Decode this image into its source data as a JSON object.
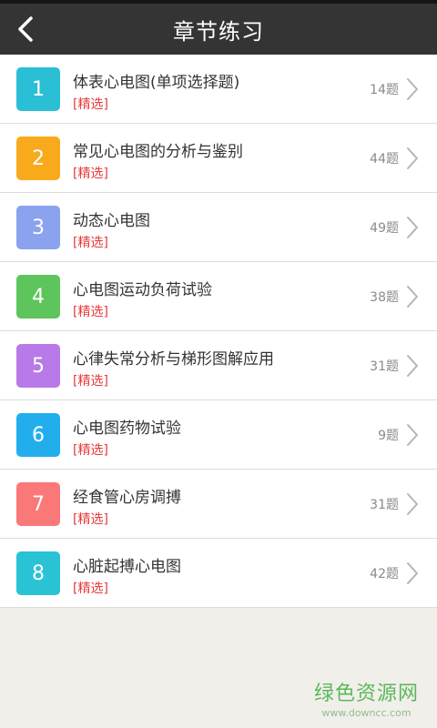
{
  "header": {
    "title": "章节练习"
  },
  "chapters": [
    {
      "num": "1",
      "name": "体表心电图(单项选择题)",
      "tag": "[精选]",
      "count": "14题",
      "color": "#2bbfd6"
    },
    {
      "num": "2",
      "name": "常见心电图的分析与鉴别",
      "tag": "[精选]",
      "count": "44题",
      "color": "#f9aa1c"
    },
    {
      "num": "3",
      "name": "动态心电图",
      "tag": "[精选]",
      "count": "49题",
      "color": "#8ba2ee"
    },
    {
      "num": "4",
      "name": "心电图运动负荷试验",
      "tag": "[精选]",
      "count": "38题",
      "color": "#5dc55b"
    },
    {
      "num": "5",
      "name": "心律失常分析与梯形图解应用",
      "tag": "[精选]",
      "count": "31题",
      "color": "#b77ae8"
    },
    {
      "num": "6",
      "name": "心电图药物试验",
      "tag": "[精选]",
      "count": "9题",
      "color": "#22aeed"
    },
    {
      "num": "7",
      "name": "经食管心房调搏",
      "tag": "[精选]",
      "count": "31题",
      "color": "#fa7878"
    },
    {
      "num": "8",
      "name": "心脏起搏心电图",
      "tag": "[精选]",
      "count": "42题",
      "color": "#29c3d5"
    }
  ],
  "watermark": {
    "title": "绿色资源网",
    "url": "www.downcc.com"
  }
}
